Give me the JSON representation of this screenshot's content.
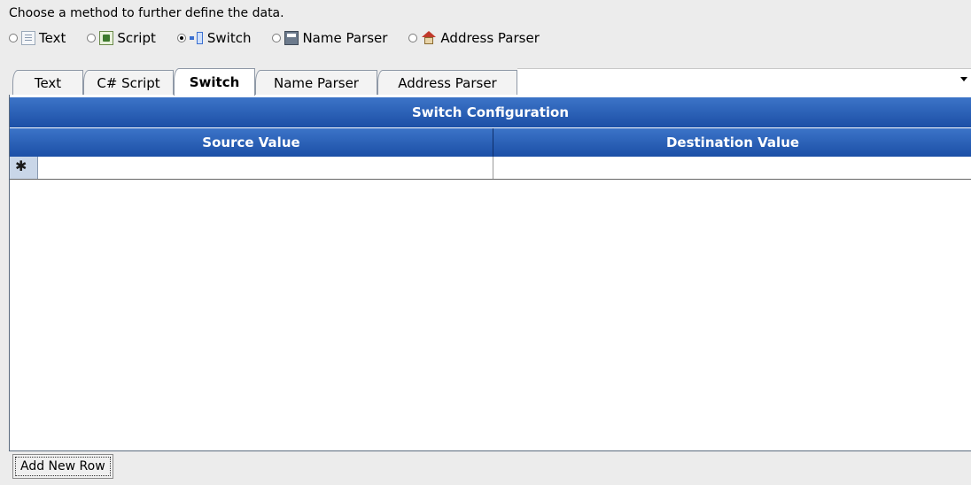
{
  "prompt": "Choose a method to further define the data.",
  "methods": [
    {
      "label": "Text",
      "icon": "text-icon",
      "selected": false
    },
    {
      "label": "Script",
      "icon": "script-icon",
      "selected": false
    },
    {
      "label": "Switch",
      "icon": "switch-icon",
      "selected": true
    },
    {
      "label": "Name Parser",
      "icon": "name-parser-icon",
      "selected": false
    },
    {
      "label": "Address Parser",
      "icon": "address-parser-icon",
      "selected": false
    }
  ],
  "tabs": [
    {
      "label": "Text",
      "active": false
    },
    {
      "label": "C# Script",
      "active": false
    },
    {
      "label": "Switch",
      "active": true
    },
    {
      "label": "Name Parser",
      "active": false
    },
    {
      "label": "Address Parser",
      "active": false
    }
  ],
  "grid": {
    "caption": "Switch Configuration",
    "columns": [
      "Source Value",
      "Destination Value"
    ],
    "new_row_glyph": "✱",
    "rows": [
      {
        "source": "",
        "destination": ""
      }
    ]
  },
  "add_row_label": "Add New Row",
  "colors": {
    "header_blue": "#1c4fa6",
    "panel_bg": "#ececec"
  }
}
